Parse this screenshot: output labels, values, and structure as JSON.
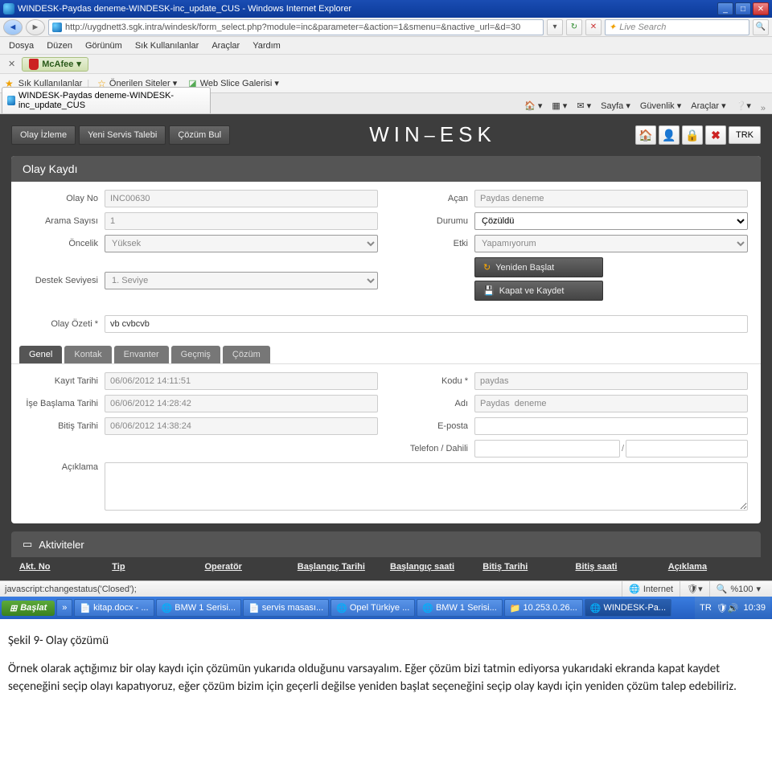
{
  "titlebar": {
    "text": "WINDESK-Paydas deneme-WINDESK-inc_update_CUS - Windows Internet Explorer"
  },
  "url": "http://uygdnett3.sgk.intra/windesk/form_select.php?module=inc&parameter=&action=1&smenu=&nactive_url=&d=30",
  "search_placeholder": "Live Search",
  "menu": [
    "Dosya",
    "Düzen",
    "Görünüm",
    "Sık Kullanılanlar",
    "Araçlar",
    "Yardım"
  ],
  "mcafee": "McAfee",
  "favbar": {
    "label": "Sık Kullanılanlar",
    "items": [
      "Önerilen Siteler ▾",
      "Web Slice Galerisi ▾"
    ]
  },
  "ietab": "WINDESK-Paydas deneme-WINDESK-inc_update_CUS",
  "iebtns": [
    "Sayfa ▾",
    "Güvenlik ▾",
    "Araçlar ▾"
  ],
  "nav": {
    "olay_izleme": "Olay İzleme",
    "yeni_servis": "Yeni Servis Talebi",
    "cozum_bul": "Çözüm Bul",
    "lang": "TRK"
  },
  "logo": "WIN⎯ESK",
  "card_title": "Olay Kaydı",
  "form": {
    "olay_no_l": "Olay No",
    "olay_no_v": "INC00630",
    "acan_l": "Açan",
    "acan_v": "Paydas deneme",
    "arama_l": "Arama Sayısı",
    "arama_v": "1",
    "durum_l": "Durumu",
    "durum_v": "Çözüldü",
    "oncelik_l": "Öncelik",
    "oncelik_v": "Yüksek",
    "etki_l": "Etki",
    "etki_v": "Yapamıyorum",
    "destek_l": "Destek Seviyesi",
    "destek_v": "1. Seviye",
    "yeniden": "Yeniden Başlat",
    "kapat": "Kapat ve Kaydet",
    "ozet_l": "Olay Özeti *",
    "ozet_v": "vb cvbcvb"
  },
  "tabs": [
    "Genel",
    "Kontak",
    "Envanter",
    "Geçmiş",
    "Çözüm"
  ],
  "detail": {
    "kayit_l": "Kayıt Tarihi",
    "kayit_v": "06/06/2012 14:11:51",
    "kodu_l": "Kodu *",
    "kodu_v": "paydas",
    "ise_l": "İşe Başlama Tarihi",
    "ise_v": "06/06/2012 14:28:42",
    "adi_l": "Adı",
    "adi_v": "Paydas  deneme",
    "bitis_l": "Bitiş Tarihi",
    "bitis_v": "06/06/2012 14:38:24",
    "eposta_l": "E-posta",
    "eposta_v": "",
    "tel_l": "Telefon / Dahili",
    "tel_sep": "/",
    "aciklama_l": "Açıklama"
  },
  "aktiv_title": "Aktiviteler",
  "aktiv_cols": [
    "Akt. No",
    "Tip",
    "Operatör",
    "Başlangıç Tarihi",
    "Başlangıç saati",
    "Bitiş Tarihi",
    "Bitiş saati",
    "Açıklama"
  ],
  "status": {
    "left": "javascript:changestatus('Closed');",
    "internet": "Internet",
    "zoom": "%100"
  },
  "taskbar": {
    "start": "Başlat",
    "items": [
      "kitap.docx - ...",
      "BMW 1 Serisi...",
      "servis masası...",
      "Opel Türkiye ...",
      "BMW 1 Serisi...",
      "10.253.0.26...",
      "WINDESK-Pa..."
    ],
    "tray_lang": "TR",
    "tray_time": "10:39"
  },
  "doc": {
    "caption": "Şekil 9- Olay çözümü",
    "body": "Örnek olarak açtığımız bir olay kaydı için çözümün yukarıda olduğunu varsayalım. Eğer çözüm bizi tatmin ediyorsa yukarıdaki ekranda kapat kaydet seçeneğini seçip olayı kapatıyoruz, eğer çözüm bizim için geçerli değilse yeniden başlat seçeneğini seçip olay kaydı için yeniden çözüm talep edebiliriz."
  }
}
